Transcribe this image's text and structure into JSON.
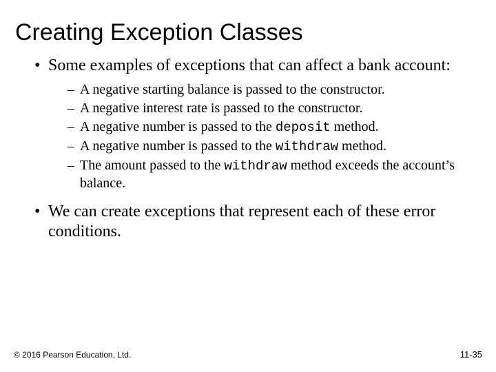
{
  "title": "Creating Exception Classes",
  "bullets": {
    "b1": "Some examples of exceptions that can affect a bank account:",
    "sub": {
      "s1": "A negative starting balance is passed to the constructor.",
      "s2": "A negative interest rate is passed to the constructor.",
      "s3a": "A negative number is passed to the ",
      "s3code": "deposit",
      "s3b": " method.",
      "s4a": "A negative number is passed to the ",
      "s4code": "withdraw",
      "s4b": " method.",
      "s5a": "The amount passed to the ",
      "s5code": "withdraw",
      "s5b": " method exceeds the account’s balance."
    },
    "b2": "We can create exceptions that represent each of these error conditions."
  },
  "footer": {
    "copyright": "© 2016 Pearson Education, Ltd.",
    "pagenum": "11-35"
  }
}
